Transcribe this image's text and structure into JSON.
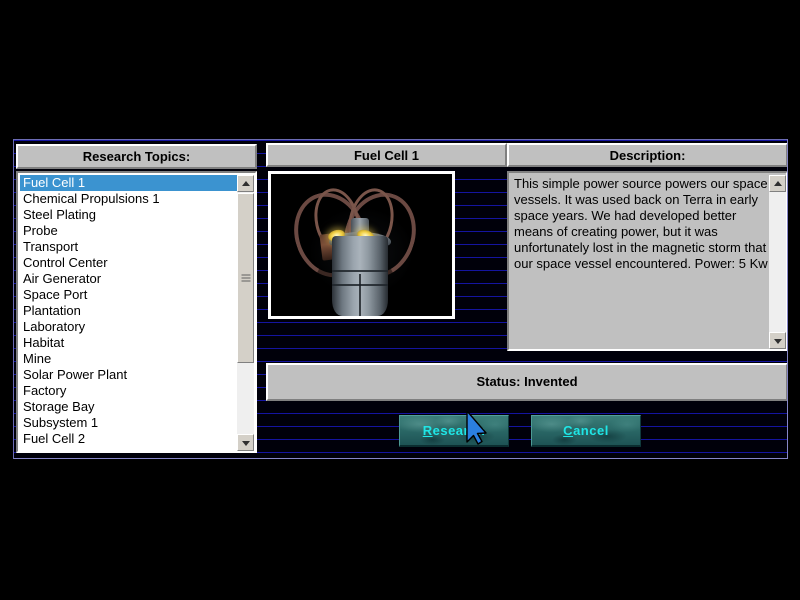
{
  "window": {
    "background_color": "#000005",
    "scanline_color": "#1414a0",
    "border_color": "#6b6bb4"
  },
  "topics_panel": {
    "header": "Research Topics:",
    "selected_index": 0,
    "items": [
      "Fuel Cell 1",
      "Chemical Propulsions 1",
      "Steel Plating",
      "Probe",
      "Transport",
      "Control Center",
      "Air Generator",
      "Space Port",
      "Plantation",
      "Laboratory",
      "Habitat",
      "Mine",
      "Solar Power Plant",
      "Factory",
      "Storage Bay",
      "Subsystem 1",
      "Fuel Cell 2"
    ],
    "scrollbar": {
      "up_arrow_icon": "triangle-up-icon",
      "down_arrow_icon": "triangle-down-icon",
      "thumb_grip_icon": "grip-lines-icon"
    },
    "selection_color": "#3b93d0"
  },
  "image_panel": {
    "header": "Fuel Cell 1",
    "artwork_name": "fuel-cell-1-render",
    "artwork_description": "Grey cylindrical fuel cell with copper coils and two glowing yellow lamps on a black background"
  },
  "description_panel": {
    "header": "Description:",
    "body": "This simple power source powers our space vessels.  It was used back on Terra in early space years. We had developed better means of creating power, but it was unfortunately lost in the magnetic storm that our space vessel encountered.  Power: 5 Kw",
    "scrollbar": {
      "up_arrow_icon": "triangle-up-icon",
      "down_arrow_icon": "triangle-down-icon"
    }
  },
  "status": {
    "text": "Status: Invented"
  },
  "buttons": {
    "research": {
      "accesskey": "R",
      "rest": "esearch",
      "text_color": "#1fe6e6"
    },
    "cancel": {
      "accesskey": "C",
      "rest": "ancel",
      "text_color": "#1fe6e6"
    }
  },
  "cursor": {
    "icon": "mouse-pointer-icon",
    "fill_color": "#2b7fe0"
  }
}
